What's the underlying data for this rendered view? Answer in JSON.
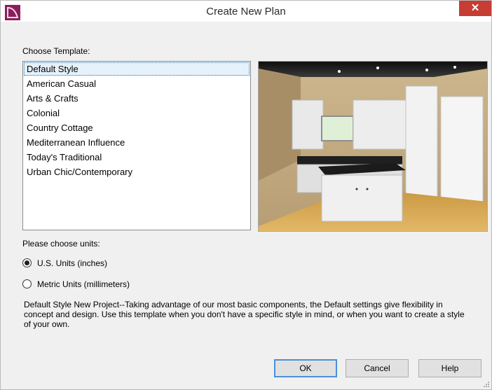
{
  "window": {
    "title": "Create New Plan",
    "close_glyph": "✕"
  },
  "choose_template_label": "Choose Template:",
  "templates": [
    "Default Style",
    "American Casual",
    "Arts & Crafts",
    "Colonial",
    "Country Cottage",
    "Mediterranean Influence",
    "Today's Traditional",
    "Urban Chic/Contemporary"
  ],
  "selected_template": "Default Style",
  "units_label": "Please choose units:",
  "units": [
    {
      "label": "U.S. Units (inches)",
      "checked": true
    },
    {
      "label": "Metric Units (millimeters)",
      "checked": false
    }
  ],
  "description": "Default Style New Project--Taking advantage of our most basic components, the Default settings give flexibility in concept and design. Use this template when you don't have a specific style in mind, or when you want to create a style of your own.",
  "buttons": {
    "ok": "OK",
    "cancel": "Cancel",
    "help": "Help"
  },
  "colors": {
    "accent": "#4a90d9",
    "close": "#c73c33",
    "app_icon": "#8b1d5c"
  }
}
